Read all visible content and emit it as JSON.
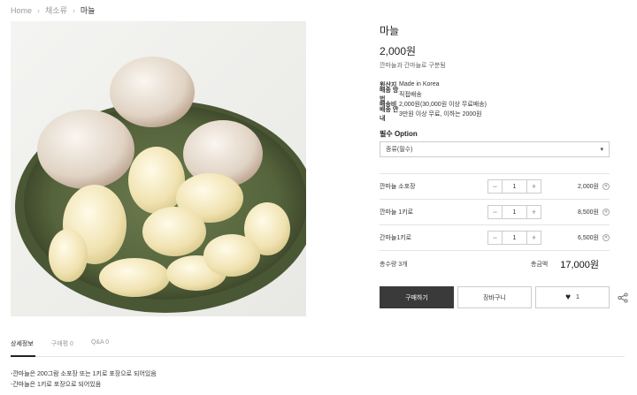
{
  "breadcrumb": {
    "home": "Home",
    "category": "채소류",
    "current": "마늘"
  },
  "product": {
    "title": "마늘",
    "price": "2,000원",
    "description": "깐마늘과 간마늘로 구분됨"
  },
  "meta": [
    {
      "key": "원산지",
      "value": "Made in Korea"
    },
    {
      "key": "배송 방법",
      "value": "직접배송"
    },
    {
      "key": "배송비",
      "value": "2,000원(30,000원 이상 무료배송)"
    },
    {
      "key": "배송 안내",
      "value": "3만원 이상 무료, 이하는 2000원"
    }
  ],
  "option": {
    "label": "필수 Option",
    "selected": "종류(필수)"
  },
  "items": [
    {
      "name": "깐마늘 소포장",
      "qty": "1",
      "price": "2,000원"
    },
    {
      "name": "깐마늘 1키로",
      "qty": "1",
      "price": "8,500원"
    },
    {
      "name": "간마늘1키로",
      "qty": "1",
      "price": "6,500원"
    }
  ],
  "total": {
    "label": "총수량 3개",
    "amount_label": "총금액",
    "amount": "17,000원"
  },
  "actions": {
    "buy": "구매하기",
    "cart": "장바구니",
    "wish_count": "1"
  },
  "tabs": [
    "상세정보",
    "구매평 0",
    "Q&A 0"
  ],
  "details": [
    "-깐마늘은 200그람 소포장 또는 1키로 포장으로 되어있음",
    "-간마늘은 1키로 포장으로 되어있음"
  ]
}
